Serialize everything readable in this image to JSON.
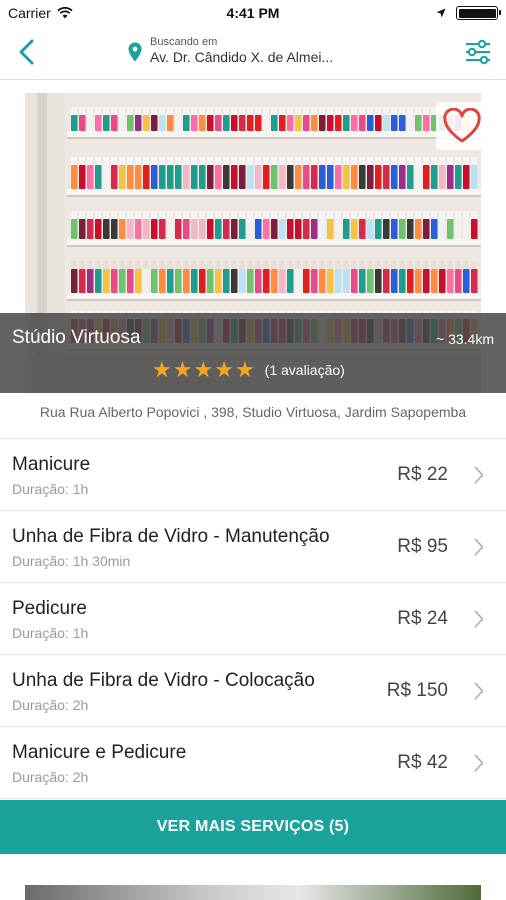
{
  "status_bar": {
    "carrier": "Carrier",
    "time": "4:41 PM"
  },
  "nav": {
    "location_label": "Buscando em",
    "location_value": "Av. Dr. Cândido X. de Almei..."
  },
  "colors": {
    "accent": "#1aa39a",
    "star": "#f4a623",
    "heart": "#e0443c"
  },
  "icons": {
    "back": "chevron-left-icon",
    "location": "map-pin-icon",
    "filter": "sliders-icon",
    "favorite": "heart-icon",
    "row_action": "chevron-right-icon"
  },
  "salon": {
    "name": "Stúdio Virtuosa",
    "distance": "~ 33.4km",
    "rating": 5,
    "rating_max": 5,
    "reviews_text": "(1 avaliação)",
    "address": "Rua Rua Alberto Popovici , 398, Studio Virtuosa, Jardim Sapopemba"
  },
  "services": [
    {
      "name": "Manicure",
      "duration": "Duração: 1h",
      "price": "R$ 22"
    },
    {
      "name": "Unha de Fibra de Vidro - Manutenção",
      "duration": "Duração: 1h 30min",
      "price": "R$ 95"
    },
    {
      "name": "Pedicure",
      "duration": "Duração: 1h",
      "price": "R$ 24"
    },
    {
      "name": "Unha de Fibra de Vidro - Colocação",
      "duration": "Duração: 2h",
      "price": "R$ 150"
    },
    {
      "name": "Manicure e Pedicure",
      "duration": "Duração: 2h",
      "price": "R$ 42"
    }
  ],
  "more_button": "VER MAIS SERVIÇOS (5)"
}
